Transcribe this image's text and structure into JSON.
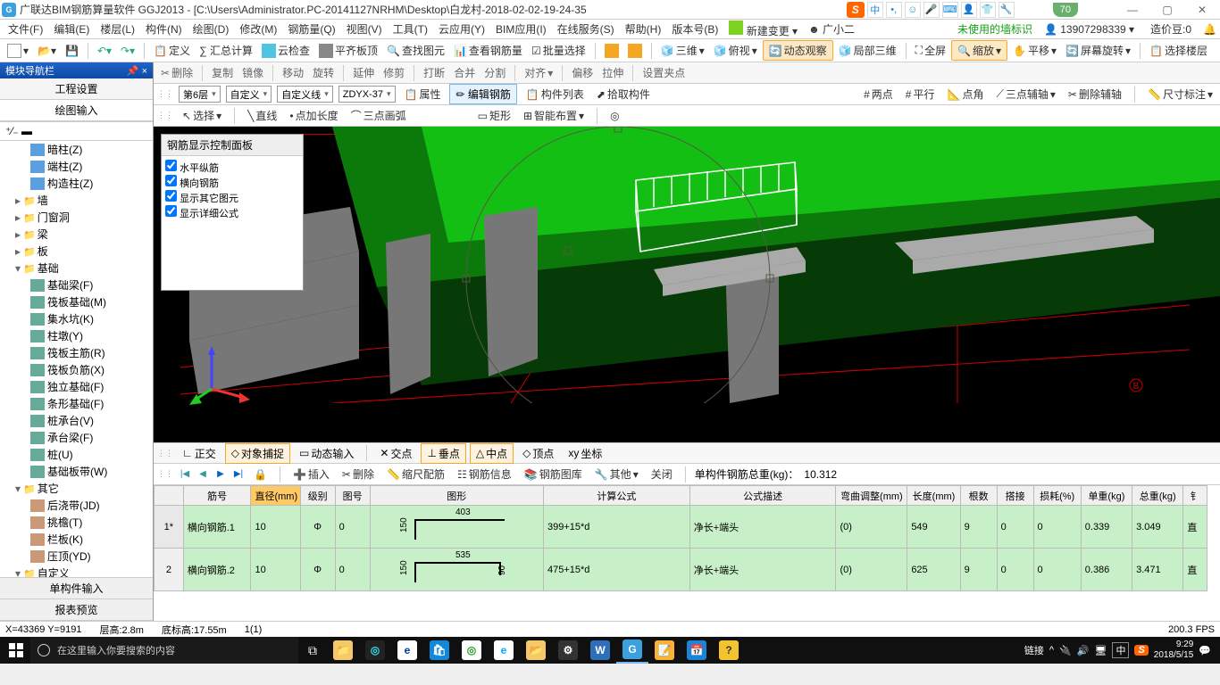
{
  "titlebar": {
    "title": "广联达BIM钢筋算量软件 GGJ2013 - [C:\\Users\\Administrator.PC-20141127NRHM\\Desktop\\白龙村-2018-02-02-19-24-35",
    "green_badge": "70"
  },
  "menubar": {
    "items": [
      "文件(F)",
      "编辑(E)",
      "楼层(L)",
      "构件(N)",
      "绘图(D)",
      "修改(M)",
      "钢筋量(Q)",
      "视图(V)",
      "工具(T)",
      "云应用(Y)",
      "BIM应用(I)",
      "在线服务(S)",
      "帮助(H)",
      "版本号(B)"
    ],
    "new_change": "新建变更",
    "user_small": "广小二",
    "unused": "未使用的墙标识",
    "phone": "13907298339",
    "coin": "造价豆:0"
  },
  "toolbar1": {
    "define": "定义",
    "sum": "∑ 汇总计算",
    "cloud": "云检查",
    "flat": "平齐板顶",
    "findimg": "查找图元",
    "viewsteel": "查看钢筋量",
    "batch": "批量选择",
    "d3": "三维",
    "look": "俯视",
    "dynview": "动态观察",
    "local3d": "局部三维",
    "fullscr": "全屏",
    "zoom": "缩放",
    "pan": "平移",
    "screenrot": "屏幕旋转",
    "selfloor": "选择楼层"
  },
  "editbar": {
    "items": [
      "删除",
      "复制",
      "镜像",
      "移动",
      "旋转",
      "延伸",
      "修剪",
      "打断",
      "合并",
      "分割",
      "对齐",
      "偏移",
      "拉伸",
      "设置夹点"
    ]
  },
  "selectbar": {
    "floor": "第6层",
    "custom": "自定义",
    "customline": "自定义线",
    "code": "ZDYX-37",
    "attr": "属性",
    "editsteel": "编辑钢筋",
    "memberlist": "构件列表",
    "pick": "拾取构件",
    "twopoint": "两点",
    "parallel": "平行",
    "angle": "点角",
    "threeaxis": "三点辅轴",
    "delaxis": "删除辅轴",
    "dim": "尺寸标注"
  },
  "drawbar": {
    "select": "选择",
    "line": "直线",
    "ptlen": "点加长度",
    "arc3": "三点画弧",
    "rect": "矩形",
    "smart": "智能布置"
  },
  "floatpanel": {
    "title": "钢筋显示控制面板",
    "opts": [
      "水平纵筋",
      "横向钢筋",
      "显示其它图元",
      "显示详细公式"
    ]
  },
  "snapbar": {
    "ortho": "正交",
    "snap": "对象捕捉",
    "dyn": "动态输入",
    "cross": "交点",
    "perp": "垂点",
    "mid": "中点",
    "top": "顶点",
    "coord": "坐标"
  },
  "databar": {
    "insert": "插入",
    "delete": "删除",
    "scale": "缩尺配筋",
    "info": "钢筋信息",
    "lib": "钢筋图库",
    "other": "其他",
    "close": "关闭",
    "weight_label": "单构件钢筋总重(kg)：",
    "weight": "10.312"
  },
  "grid": {
    "headers": [
      "",
      "筋号",
      "直径(mm)",
      "级别",
      "图号",
      "图形",
      "计算公式",
      "公式描述",
      "弯曲调整(mm)",
      "长度(mm)",
      "根数",
      "搭接",
      "损耗(%)",
      "单重(kg)",
      "总重(kg)",
      "钅"
    ],
    "rows": [
      {
        "idx": "1*",
        "name": "横向钢筋.1",
        "dia": "10",
        "grade": "Φ",
        "fig": "0",
        "shape_t": "403",
        "shape_l": "150",
        "calc": "399+15*d",
        "desc": "净长+端头",
        "bend": "(0)",
        "len": "549",
        "cnt": "9",
        "lap": "0",
        "loss": "0",
        "uw": "0.339",
        "tw": "3.049",
        "t": "直"
      },
      {
        "idx": "2",
        "name": "横向钢筋.2",
        "dia": "10",
        "grade": "Φ",
        "fig": "0",
        "shape_t": "535",
        "shape_l": "150",
        "shape_r": "90",
        "calc": "475+15*d",
        "desc": "净长+端头",
        "bend": "(0)",
        "len": "625",
        "cnt": "9",
        "lap": "0",
        "loss": "0",
        "uw": "0.386",
        "tw": "3.471",
        "t": "直"
      }
    ]
  },
  "statusbar": {
    "coord": "X=43369 Y=9191",
    "floorh": "层高:2.8m",
    "bottomh": "底标高:17.55m",
    "sel": "1(1)",
    "fps": "200.3 FPS"
  },
  "taskbar": {
    "search": "在这里输入你要搜索的内容",
    "link": "链接",
    "ime": "中",
    "time": "9:29",
    "date": "2018/5/15"
  }
}
